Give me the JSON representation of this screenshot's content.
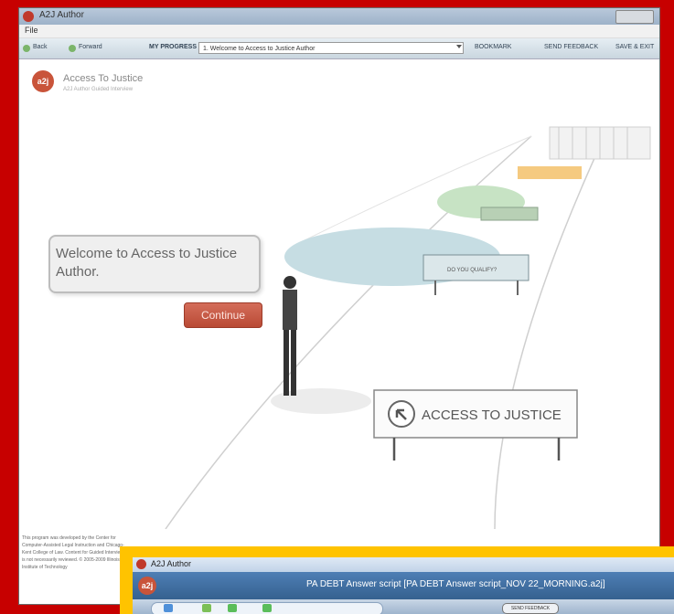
{
  "window1": {
    "title": "A2J Author",
    "menu": {
      "file": "File"
    },
    "toolbar": {
      "back": "Back",
      "forward": "Forward",
      "my_progress": "MY PROGRESS",
      "selected_question": "1. Welcome to Access to Justice Author",
      "bookmark": "BOOKMARK",
      "send_feedback": "SEND FEEDBACK",
      "save_exit": "SAVE & EXIT"
    },
    "brand": {
      "name": "Access To Justice",
      "tagline": "A2J Author Guided Interview"
    },
    "scene": {
      "bubble_text": "Welcome to Access to Justice Author.",
      "continue_label": "Continue",
      "sign_small": "DO YOU QUALIFY?",
      "sign_large": "ACCESS TO JUSTICE"
    },
    "footer_text": "This program was developed by the Center for Computer-Assisted Legal Instruction and Chicago-Kent College of Law. Content for Guided Interviews is not necessarily reviewed. © 2005-2009 Illinois Institute of Technology"
  },
  "window2": {
    "title": "A2J Author",
    "logo": "a2j",
    "header_title": "PA DEBT Answer script [PA DEBT Answer script_NOV 22_MORNING.a2j]",
    "send_feedback": "SEND FEEDBACK"
  },
  "colors": {
    "frame_red": "#c70000",
    "frame_yellow": "#ffc300",
    "brand_orange": "#c9543a",
    "window2_blue": "#3f6c9e"
  }
}
